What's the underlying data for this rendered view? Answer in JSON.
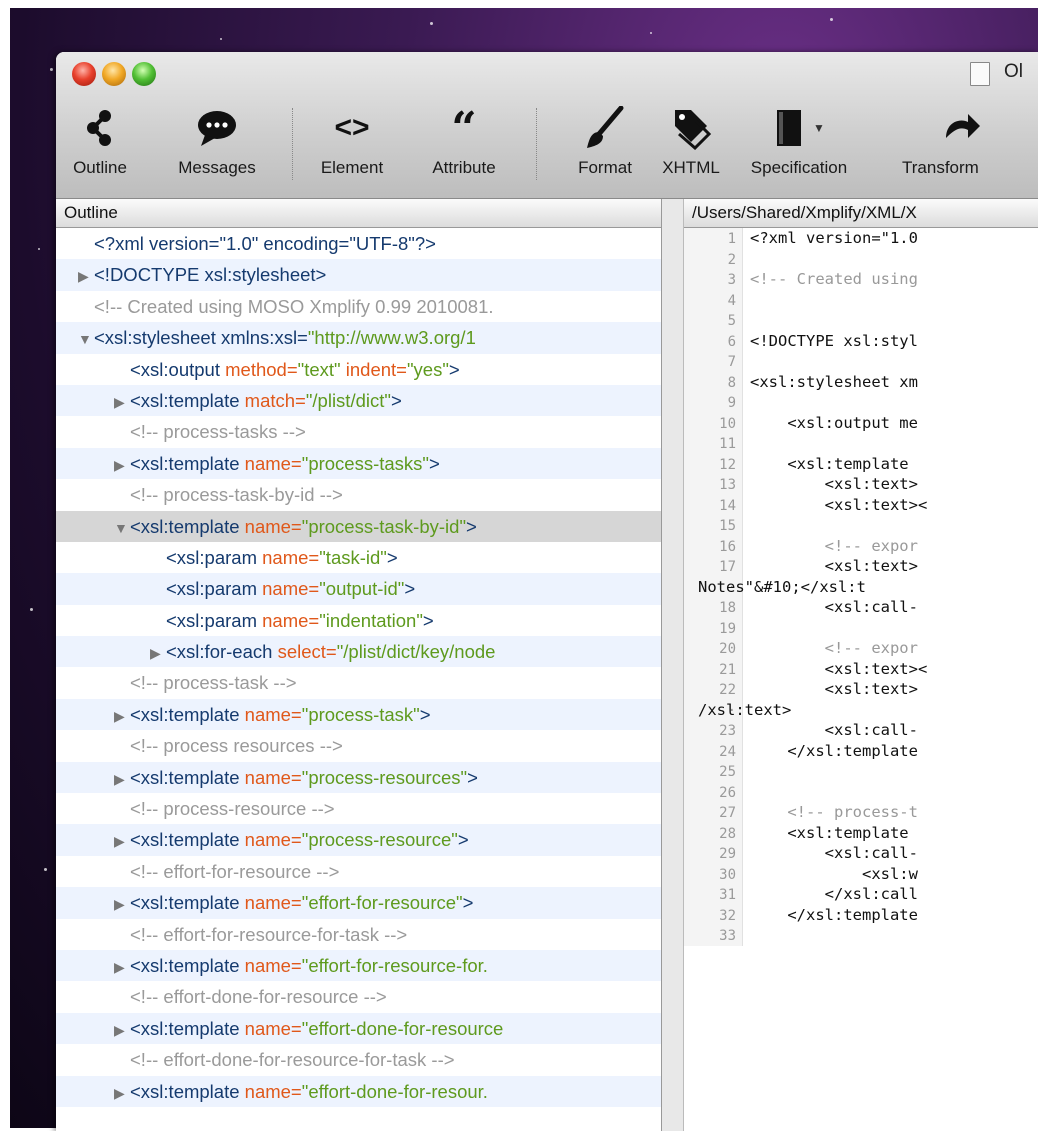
{
  "window": {
    "title": "Ol"
  },
  "toolbar": {
    "items": [
      {
        "label": "Outline",
        "icon": "outline-icon"
      },
      {
        "label": "Messages",
        "icon": "messages-icon"
      },
      {
        "label": "Element",
        "icon": "element-icon"
      },
      {
        "label": "Attribute",
        "icon": "attribute-icon"
      },
      {
        "label": "Format",
        "icon": "format-icon"
      },
      {
        "label": "XHTML",
        "icon": "xhtml-icon"
      },
      {
        "label": "Specification",
        "icon": "specification-icon"
      },
      {
        "label": "Transform",
        "icon": "transform-icon"
      }
    ]
  },
  "outline": {
    "header": "Outline",
    "rows": [
      {
        "indent": 0,
        "tri": "",
        "parts": [
          [
            "pi",
            "<?xml  version=\"1.0\" encoding=\"UTF-8\"?>"
          ]
        ]
      },
      {
        "indent": 0,
        "tri": "▶",
        "parts": [
          [
            "doctype",
            "<!DOCTYPE xsl:stylesheet>"
          ]
        ]
      },
      {
        "indent": 0,
        "tri": "",
        "parts": [
          [
            "cmt",
            "<!-- Created using MOSO Xmplify 0.99 2010081."
          ]
        ]
      },
      {
        "indent": 0,
        "tri": "▼",
        "parts": [
          [
            "tag",
            "<xsl:stylesheet xmlns:xsl="
          ],
          [
            "val",
            "\"http://www.w3.org/1"
          ]
        ]
      },
      {
        "indent": 1,
        "tri": "",
        "parts": [
          [
            "tag",
            "<xsl:output "
          ],
          [
            "attr",
            "method="
          ],
          [
            "val",
            "\"text\" "
          ],
          [
            "attr",
            "indent="
          ],
          [
            "val",
            "\"yes\""
          ],
          [
            "tag",
            ">"
          ]
        ]
      },
      {
        "indent": 1,
        "tri": "▶",
        "parts": [
          [
            "tag",
            "<xsl:template "
          ],
          [
            "attr",
            "match="
          ],
          [
            "val",
            "\"/plist/dict\""
          ],
          [
            "tag",
            ">"
          ]
        ]
      },
      {
        "indent": 1,
        "tri": "",
        "parts": [
          [
            "cmt",
            "<!-- process-tasks -->"
          ]
        ]
      },
      {
        "indent": 1,
        "tri": "▶",
        "parts": [
          [
            "tag",
            "<xsl:template "
          ],
          [
            "attr",
            "name="
          ],
          [
            "val",
            "\"process-tasks\""
          ],
          [
            "tag",
            ">"
          ]
        ]
      },
      {
        "indent": 1,
        "tri": "",
        "parts": [
          [
            "cmt",
            "<!-- process-task-by-id -->"
          ]
        ]
      },
      {
        "indent": 1,
        "tri": "▼",
        "parts": [
          [
            "tag",
            "<xsl:template "
          ],
          [
            "attr",
            "name="
          ],
          [
            "val",
            "\"process-task-by-id\""
          ],
          [
            "tag",
            ">"
          ]
        ],
        "selected": true
      },
      {
        "indent": 2,
        "tri": "",
        "parts": [
          [
            "tag",
            "<xsl:param "
          ],
          [
            "attr",
            "name="
          ],
          [
            "val",
            "\"task-id\""
          ],
          [
            "tag",
            ">"
          ]
        ]
      },
      {
        "indent": 2,
        "tri": "",
        "parts": [
          [
            "tag",
            "<xsl:param "
          ],
          [
            "attr",
            "name="
          ],
          [
            "val",
            "\"output-id\""
          ],
          [
            "tag",
            ">"
          ]
        ]
      },
      {
        "indent": 2,
        "tri": "",
        "parts": [
          [
            "tag",
            "<xsl:param "
          ],
          [
            "attr",
            "name="
          ],
          [
            "val",
            "\"indentation\""
          ],
          [
            "tag",
            ">"
          ]
        ]
      },
      {
        "indent": 2,
        "tri": "▶",
        "parts": [
          [
            "tag",
            "<xsl:for-each "
          ],
          [
            "attr",
            "select="
          ],
          [
            "val",
            "\"/plist/dict/key/node"
          ]
        ]
      },
      {
        "indent": 1,
        "tri": "",
        "parts": [
          [
            "cmt",
            "<!-- process-task -->"
          ]
        ]
      },
      {
        "indent": 1,
        "tri": "▶",
        "parts": [
          [
            "tag",
            "<xsl:template "
          ],
          [
            "attr",
            "name="
          ],
          [
            "val",
            "\"process-task\""
          ],
          [
            "tag",
            ">"
          ]
        ]
      },
      {
        "indent": 1,
        "tri": "",
        "parts": [
          [
            "cmt",
            "<!-- process resources -->"
          ]
        ]
      },
      {
        "indent": 1,
        "tri": "▶",
        "parts": [
          [
            "tag",
            "<xsl:template "
          ],
          [
            "attr",
            "name="
          ],
          [
            "val",
            "\"process-resources\""
          ],
          [
            "tag",
            ">"
          ]
        ]
      },
      {
        "indent": 1,
        "tri": "",
        "parts": [
          [
            "cmt",
            "<!-- process-resource -->"
          ]
        ]
      },
      {
        "indent": 1,
        "tri": "▶",
        "parts": [
          [
            "tag",
            "<xsl:template "
          ],
          [
            "attr",
            "name="
          ],
          [
            "val",
            "\"process-resource\""
          ],
          [
            "tag",
            ">"
          ]
        ]
      },
      {
        "indent": 1,
        "tri": "",
        "parts": [
          [
            "cmt",
            "<!-- effort-for-resource -->"
          ]
        ]
      },
      {
        "indent": 1,
        "tri": "▶",
        "parts": [
          [
            "tag",
            "<xsl:template "
          ],
          [
            "attr",
            "name="
          ],
          [
            "val",
            "\"effort-for-resource\""
          ],
          [
            "tag",
            ">"
          ]
        ]
      },
      {
        "indent": 1,
        "tri": "",
        "parts": [
          [
            "cmt",
            "<!-- effort-for-resource-for-task -->"
          ]
        ]
      },
      {
        "indent": 1,
        "tri": "▶",
        "parts": [
          [
            "tag",
            "<xsl:template "
          ],
          [
            "attr",
            "name="
          ],
          [
            "val",
            "\"effort-for-resource-for."
          ]
        ]
      },
      {
        "indent": 1,
        "tri": "",
        "parts": [
          [
            "cmt",
            "<!-- effort-done-for-resource -->"
          ]
        ]
      },
      {
        "indent": 1,
        "tri": "▶",
        "parts": [
          [
            "tag",
            "<xsl:template "
          ],
          [
            "attr",
            "name="
          ],
          [
            "val",
            "\"effort-done-for-resource"
          ]
        ]
      },
      {
        "indent": 1,
        "tri": "",
        "parts": [
          [
            "cmt",
            "<!-- effort-done-for-resource-for-task -->"
          ]
        ]
      },
      {
        "indent": 1,
        "tri": "▶",
        "parts": [
          [
            "tag",
            "<xsl:template "
          ],
          [
            "attr",
            "name="
          ],
          [
            "val",
            "\"effort-done-for-resour."
          ]
        ]
      }
    ]
  },
  "code": {
    "path": "/Users/Shared/Xmplify/XML/X",
    "lines": [
      {
        "n": "1",
        "t": "<?xml version=\"1.0",
        "c": "txt"
      },
      {
        "n": "2",
        "t": "",
        "c": "txt"
      },
      {
        "n": "3",
        "t": "<!-- Created using",
        "c": "cmt"
      },
      {
        "n": "4",
        "t": "",
        "c": "txt"
      },
      {
        "n": "5",
        "t": "",
        "c": "txt"
      },
      {
        "n": "6",
        "t": "<!DOCTYPE xsl:styl",
        "c": "txt"
      },
      {
        "n": "7",
        "t": "",
        "c": "txt"
      },
      {
        "n": "8",
        "t": "<xsl:stylesheet xm",
        "c": "txt"
      },
      {
        "n": "9",
        "t": "",
        "c": "txt"
      },
      {
        "n": "10",
        "t": "    <xsl:output me",
        "c": "txt"
      },
      {
        "n": "11",
        "t": "",
        "c": "txt"
      },
      {
        "n": "12",
        "t": "    <xsl:template ",
        "c": "txt"
      },
      {
        "n": "13",
        "t": "        <xsl:text>",
        "c": "txt"
      },
      {
        "n": "14",
        "t": "        <xsl:text><",
        "c": "txt"
      },
      {
        "n": "15",
        "t": "",
        "c": "txt"
      },
      {
        "n": "16",
        "t": "        <!-- expor",
        "c": "cmt"
      },
      {
        "n": "17",
        "t": "        <xsl:text>",
        "c": "txt"
      },
      {
        "n": "·",
        "t": "Notes\"&#10;</xsl:t",
        "c": "txt",
        "wrap": true
      },
      {
        "n": "18",
        "t": "        <xsl:call-",
        "c": "txt"
      },
      {
        "n": "19",
        "t": "",
        "c": "txt"
      },
      {
        "n": "20",
        "t": "        <!-- expor",
        "c": "cmt"
      },
      {
        "n": "21",
        "t": "        <xsl:text><",
        "c": "txt"
      },
      {
        "n": "22",
        "t": "        <xsl:text>",
        "c": "txt"
      },
      {
        "n": "·",
        "t": "/xsl:text>",
        "c": "txt",
        "wrap": true
      },
      {
        "n": "23",
        "t": "        <xsl:call-",
        "c": "txt"
      },
      {
        "n": "24",
        "t": "    </xsl:template",
        "c": "txt"
      },
      {
        "n": "25",
        "t": "",
        "c": "txt"
      },
      {
        "n": "26",
        "t": "",
        "c": "txt"
      },
      {
        "n": "27",
        "t": "    <!-- process-t",
        "c": "cmt"
      },
      {
        "n": "28",
        "t": "    <xsl:template ",
        "c": "txt"
      },
      {
        "n": "29",
        "t": "        <xsl:call-",
        "c": "txt"
      },
      {
        "n": "30",
        "t": "            <xsl:w",
        "c": "txt"
      },
      {
        "n": "31",
        "t": "        </xsl:call",
        "c": "txt"
      },
      {
        "n": "32",
        "t": "    </xsl:template",
        "c": "txt"
      },
      {
        "n": "33",
        "t": "",
        "c": "txt"
      }
    ]
  }
}
